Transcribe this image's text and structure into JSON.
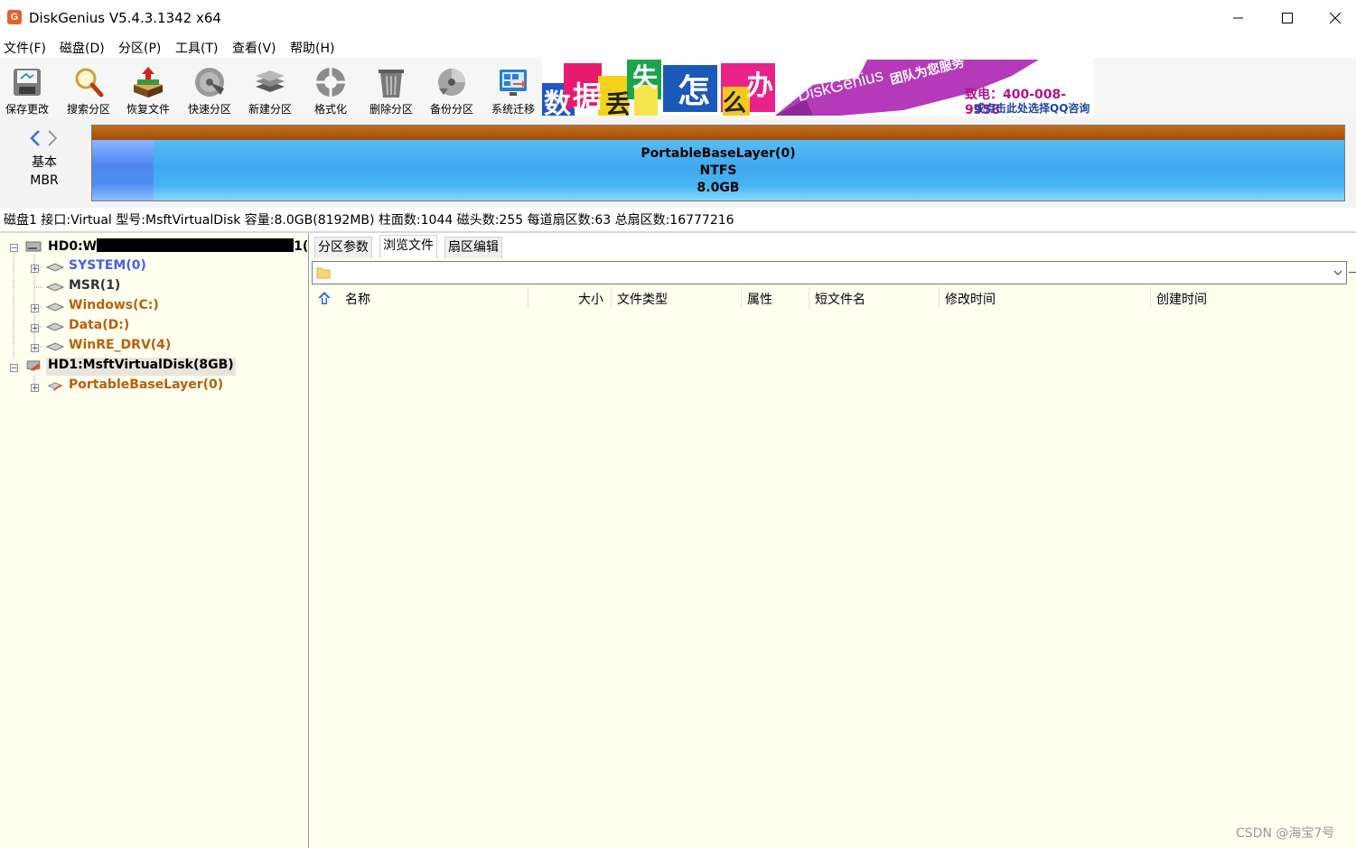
{
  "window": {
    "title": "DiskGenius V5.4.3.1342 x64",
    "app_icon_letter": "G"
  },
  "menu": [
    "文件(F)",
    "磁盘(D)",
    "分区(P)",
    "工具(T)",
    "查看(V)",
    "帮助(H)"
  ],
  "toolbar": {
    "buttons": [
      {
        "label": "保存更改",
        "icon": "save-icon"
      },
      {
        "label": "搜索分区",
        "icon": "search-icon"
      },
      {
        "label": "恢复文件",
        "icon": "recover-file-icon"
      },
      {
        "label": "快速分区",
        "icon": "quick-partition-icon"
      },
      {
        "label": "新建分区",
        "icon": "new-partition-icon"
      },
      {
        "label": "格式化",
        "icon": "format-icon"
      },
      {
        "label": "删除分区",
        "icon": "delete-partition-icon"
      },
      {
        "label": "备份分区",
        "icon": "backup-partition-icon"
      },
      {
        "label": "系统迁移",
        "icon": "system-migration-icon"
      }
    ]
  },
  "banner": {
    "chars": [
      "数",
      "据",
      "丢",
      "失",
      "怎",
      "么",
      "办",
      "!"
    ],
    "brand": "DiskGenius",
    "tagline": "团队为您服务",
    "phone": "致电：400-008-9958",
    "qq": "或点击此处选择QQ咨询"
  },
  "disk_map": {
    "type_line1": "基本",
    "type_line2": "MBR",
    "partition_name": "PortableBaseLayer(0)",
    "partition_fs": "NTFS",
    "partition_size": "8.0GB"
  },
  "disk_info": "磁盘1 接口:Virtual  型号:MsftVirtualDisk  容量:8.0GB(8192MB)  柱面数:1044  磁头数:255  每道扇区数:63  总扇区数:16777216",
  "tree": {
    "hd0_label": "HD0:W",
    "hd0_suffix": "1(",
    "hd0_partitions": [
      {
        "label": "SYSTEM(0)",
        "color": "#4a5ee8",
        "expandable": true
      },
      {
        "label": "MSR(1)",
        "color": "#333333",
        "expandable": false
      },
      {
        "label": "Windows(C:)",
        "color": "#b8600a",
        "expandable": true
      },
      {
        "label": "Data(D:)",
        "color": "#b8600a",
        "expandable": true
      },
      {
        "label": "WinRE_DRV(4)",
        "color": "#b8600a",
        "expandable": true
      }
    ],
    "hd1_label": "HD1:MsftVirtualDisk(8GB)",
    "hd1_partitions": [
      {
        "label": "PortableBaseLayer(0)",
        "color": "#b8600a",
        "expandable": true
      }
    ]
  },
  "tabs": [
    "分区参数",
    "浏览文件",
    "扇区编辑"
  ],
  "active_tab": 1,
  "path_combo": {
    "value": ""
  },
  "file_columns": [
    "名称",
    "大小",
    "文件类型",
    "属性",
    "短文件名",
    "修改时间",
    "创建时间"
  ],
  "watermark": "CSDN @海宝7号",
  "colors": {
    "panel_bg": "#fffff0",
    "partition_bar_top": "#b5600f",
    "partition_bar_body": "#47b0f0",
    "accent_orange": "#b8600a",
    "system_blue": "#4a5ee8"
  }
}
